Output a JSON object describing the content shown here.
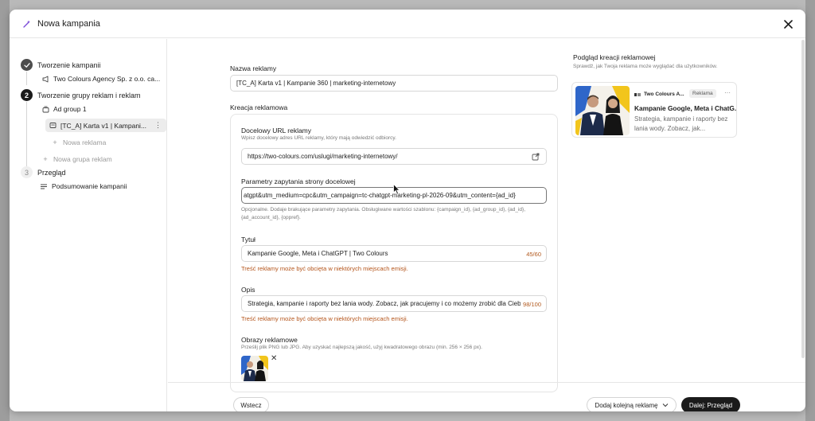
{
  "modal": {
    "title": "Nowa kampania"
  },
  "sidebar": {
    "step1": {
      "number": "",
      "label": "Tworzenie kampanii"
    },
    "advertiser": "Two Colours Agency Sp. z o.o. ca...",
    "step2": {
      "number": "2",
      "label": "Tworzenie grupy reklam i reklam"
    },
    "ad_group": "Ad group 1",
    "selected_ad": "[TC_A] Karta v1 | Kampani...",
    "new_ad": "Nowa reklama",
    "new_group": "Nowa grupa reklam",
    "step3": {
      "number": "3",
      "label": "Przegląd"
    },
    "summary": "Podsumowanie kampanii"
  },
  "form": {
    "ad_name_label": "Nazwa reklamy",
    "ad_name_value": "[TC_A] Karta v1 | Kampanie 360 | marketing-internetowy",
    "creative_label": "Kreacja reklamowa",
    "url_label": "Docelowy URL reklamy",
    "url_hint": "Wpisz docelowy adres URL reklamy, który mają odwiedzić odbiorcy.",
    "url_value": "https://two-colours.com/uslugi/marketing-internetowy/",
    "params_label": "Parametry zapytania strony docelowej",
    "params_value": "atgpt&utm_medium=cpc&utm_campaign=tc-chatgpt-marketing-pl-2026-09&utm_content={ad_id}",
    "params_hint": "Opcjonalne. Dodaje brakujące parametry zapytania. Obsługiwane wartości szablonu: {campaign_id}, {ad_group_id}, {ad_id}, {ad_account_id}, {oppref}.",
    "title_label": "Tytuł",
    "title_value": "Kampanie Google, Meta i ChatGPT | Two Colours",
    "title_counter": "45/60",
    "title_warning": "Treść reklamy może być obcięta w niektórych miejscach emisji.",
    "desc_label": "Opis",
    "desc_value": "Strategia, kampanie i raporty bez lania wody. Zobacz, jak pracujemy i co możemy zrobić dla Ciebie.",
    "desc_counter": "98/100",
    "desc_warning": "Treść reklamy może być obcięta w niektórych miejscach emisji.",
    "images_label": "Obrazy reklamowe",
    "images_hint": "Prześlij plik PNG lub JPG. Aby uzyskać najlepszą jakość, użyj kwadratowego obrazu (min. 256 × 256 px)."
  },
  "preview": {
    "title": "Podgląd kreacji reklamowej",
    "subtitle": "Sprawdź, jak Twoja reklama może wyglądać dla użytkowników.",
    "advertiser": "Two Colours A...",
    "badge": "Reklama",
    "headline": "Kampanie Google, Meta i ChatG...",
    "description": "Strategia, kampanie i raporty bez lania wody. Zobacz, jak..."
  },
  "footer": {
    "back": "Wstecz",
    "add_another": "Dodaj kolejną reklamę",
    "next": "Dalej: Przegląd"
  },
  "colors": {
    "warning": "#b4541a",
    "primary_button": "#1b1b1b",
    "brand_accent": "#7b4bd8"
  }
}
